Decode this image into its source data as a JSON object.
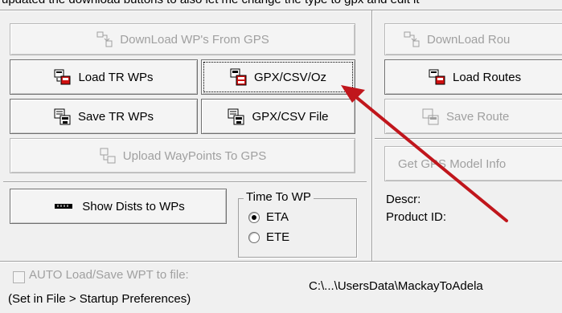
{
  "top_cut_text": "updated the download buttons to also let me change the type to gpx and edit it",
  "waypoints": {
    "download_label": "DownLoad WP's From GPS",
    "load_tr_label": "Load TR WPs",
    "gpx_csv_open_label": "GPX/CSV/Oz",
    "save_tr_label": "Save TR WPs",
    "gpx_csv_file_label": "GPX/CSV File",
    "upload_label": "Upload WayPoints To GPS",
    "show_dists_label": "Show Dists to WPs",
    "time_to_wp_legend": "Time To WP",
    "eta_label": "ETA",
    "ete_label": "ETE",
    "time_mode_selected": "ETA"
  },
  "routes": {
    "download_label": "DownLoad Rou",
    "load_label": "Load Routes",
    "save_label": "Save Route",
    "get_model_label": "Get GPS Model Info",
    "descr_label": "Descr:",
    "product_id_label": "Product ID:"
  },
  "footer": {
    "auto_checkbox_label": "AUTO Load/Save WPT to file:",
    "auto_checked": false,
    "hint": "(Set in File > Startup Preferences)",
    "path": "C:\\...\\UsersData\\MackayToAdela"
  },
  "annotation": {
    "arrow_color": "#c0161c"
  },
  "icons": {
    "download": "gps-download-icon",
    "load": "load-waypoints-icon",
    "gpx": "gpx-file-icon",
    "save": "save-waypoints-icon",
    "upload": "gps-upload-icon",
    "ruler": "ruler-icon"
  }
}
